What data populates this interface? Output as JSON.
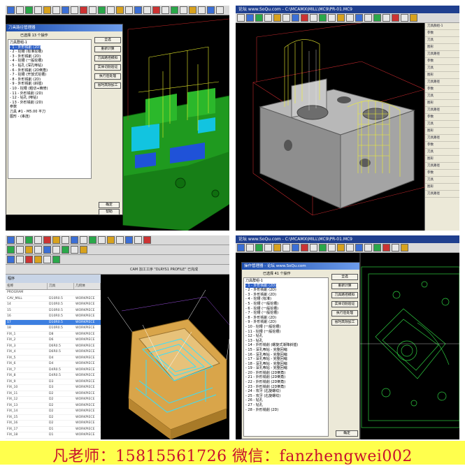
{
  "panels": {
    "p1": {
      "dialog_title": "刀具路径管理器",
      "header": "已选择 13 个操作",
      "tree": [
        "刀具群组-1",
        "- 1 - 外形铣削 (2D)",
        "- 2 - 挖槽 (标准挖槽)",
        "- 3 - 外形铣削 (2D)",
        "- 4 - 挖槽 (一般挖槽)",
        "- 5 - 钻孔 (深孔啄钻)",
        "- 6 - 外形铣削 (2D倒角)",
        "- 7 - 挖槽 (开放式挖槽)",
        "- 8 - 外形铣削 (2D)",
        "- 9 - 外形铣削 (斜插)",
        "- 10 - 挖槽 (粗切+精修)",
        "- 11 - 外形铣削 (2D)",
        "- 12 - 钻孔 (啄钻)",
        "- 13 - 外形铣削 (2D)",
        "参数",
        "刀具 #1 - M5.00 平刀",
        "图形 - (串连)"
      ],
      "buttons": [
        "全选",
        "重新计算",
        "刀具路径模拟",
        "实体切削验证",
        "执行后处理",
        "省时高效加工"
      ],
      "bottom_buttons": [
        "确定",
        "帮助"
      ]
    },
    "p2": {
      "title": "论坛 www.SoQu.com - C:\\MCAMX\\MILL\\MC9\\PR-01.MC9",
      "side_items": [
        "刀具群组-1",
        "参数",
        "刀具",
        "图形",
        "刀具路径",
        "参数",
        "刀具",
        "图形",
        "刀具路径",
        "参数",
        "刀具",
        "图形",
        "刀具路径",
        "参数",
        "刀具",
        "图形",
        "刀具路径",
        "参数",
        "刀具",
        "图形",
        "刀具路径",
        "参数",
        "刀具",
        "图形",
        "刀具路径"
      ]
    },
    "p3": {
      "header_left": "程序",
      "header_info": "CAM 加工工序 \"DLRYS1 PROFILE\" 已完成",
      "columns": [
        "名称",
        "刀具",
        "几何体"
      ],
      "rows": [
        [
          "PROGRAM",
          "",
          ""
        ],
        [
          "CAV_MILL",
          "D10R0.5",
          "WORKPIECE"
        ],
        [
          "14",
          "D10R0.5",
          "WORKPIECE"
        ],
        [
          "15",
          "D10R0.5",
          "WORKPIECE"
        ],
        [
          "16",
          "D10R0.5",
          "WORKPIECE"
        ],
        [
          "17",
          "D10R0.5",
          "WORKPIECE"
        ],
        [
          "18",
          "D10R0.5",
          "WORKPIECE"
        ],
        [
          "FIX_1",
          "D8",
          "WORKPIECE"
        ],
        [
          "FIX_2",
          "D6",
          "WORKPIECE"
        ],
        [
          "FIX_3",
          "D6R0.5",
          "WORKPIECE"
        ],
        [
          "FIX_4",
          "D6R0.5",
          "WORKPIECE"
        ],
        [
          "FIX_5",
          "D4",
          "WORKPIECE"
        ],
        [
          "FIX_6",
          "D4",
          "WORKPIECE"
        ],
        [
          "FIX_7",
          "D4R0.5",
          "WORKPIECE"
        ],
        [
          "FIX_8",
          "D4R0.5",
          "WORKPIECE"
        ],
        [
          "FIX_9",
          "D3",
          "WORKPIECE"
        ],
        [
          "FIX_10",
          "D3",
          "WORKPIECE"
        ],
        [
          "FIX_11",
          "D2",
          "WORKPIECE"
        ],
        [
          "FIX_12",
          "D2",
          "WORKPIECE"
        ],
        [
          "FIX_13",
          "D2",
          "WORKPIECE"
        ],
        [
          "FIX_14",
          "D2",
          "WORKPIECE"
        ],
        [
          "FIX_15",
          "D2",
          "WORKPIECE"
        ],
        [
          "FIX_16",
          "D2",
          "WORKPIECE"
        ],
        [
          "FIX_17",
          "D1",
          "WORKPIECE"
        ],
        [
          "FIX_18",
          "D1",
          "WORKPIECE"
        ]
      ],
      "selected_row": 5
    },
    "p4": {
      "title": "论坛 www.SoQu.com - C:\\MCAMX\\MILL\\MC9\\PR-01.MC9",
      "dialog_title": "操作管理器 - 论坛 www.SoQu.com",
      "header": "已选择 41 个操作",
      "tree": [
        "刀具群组-1",
        "- 1 - 外形铣削 (2D)",
        "- 2 - 外形铣削 (2D)",
        "- 3 - 外形铣削 (2D)",
        "- 4 - 挖槽 (标准)",
        "- 5 - 挖槽 (一般挖槽)",
        "- 6 - 挖槽 (一般挖槽)",
        "- 7 - 挖槽 (一般挖槽)",
        "- 8 - 外形铣削 (2D)",
        "- 9 - 外形铣削 (2D)",
        "- 10 - 挖槽 (一般挖槽)",
        "- 11 - 挖槽 (一般挖槽)",
        "- 12 - 钻孔",
        "- 13 - 钻孔",
        "- 14 - 外形铣削 (螺旋式渐降斜插)",
        "- 15 - 深孔啄钻 - 完整回缩",
        "- 16 - 深孔啄钻 - 完整回缩",
        "- 17 - 深孔啄钻 - 完整回缩",
        "- 18 - 深孔啄钻 - 完整回缩",
        "- 19 - 深孔啄钻 - 完整回缩",
        "- 20 - 外形铣削 (2D倒角)",
        "- 21 - 外形铣削 (2D倒角)",
        "- 22 - 外形铣削 (2D倒角)",
        "- 23 - 外形铣削 (2D倒角)",
        "- 24 - 攻牙 (右旋螺纹)",
        "- 25 - 攻牙 (右旋螺纹)",
        "- 26 - 钻孔",
        "- 27 - 钻孔",
        "- 28 - 外形铣削 (2D)"
      ],
      "buttons": [
        "全选",
        "重新计算",
        "刀具路径模拟",
        "实体切削验证",
        "执行后处理",
        "省时高效加工"
      ],
      "bottom_button": "确定"
    }
  },
  "footer": {
    "text": "凡老师：15815561726  微信：fanzhengwei002"
  }
}
